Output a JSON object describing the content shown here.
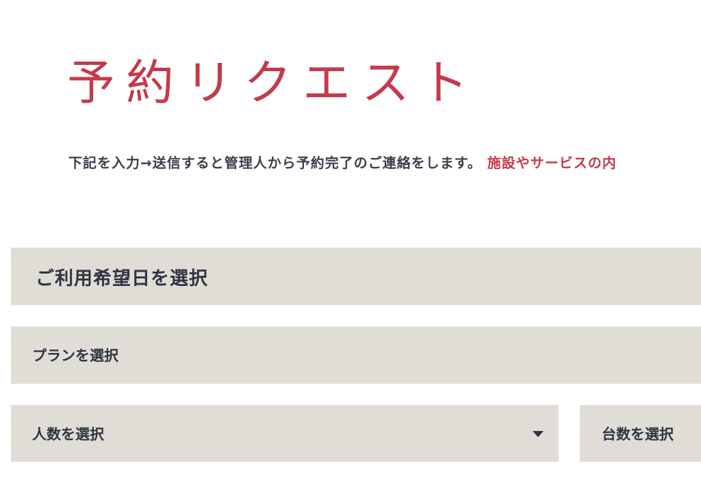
{
  "header": {
    "title": "予約リクエスト"
  },
  "intro": {
    "text": "下記を入力→送信すると管理人から予約完了のご連絡をします。",
    "accent": "施設やサービスの内"
  },
  "form": {
    "date_select": {
      "placeholder": "ご利用希望日を選択"
    },
    "plan_select": {
      "label": "プランを選択"
    },
    "people_select": {
      "label": "人数を選択",
      "icon": "caret-down-icon"
    },
    "cars_select": {
      "label": "台数を選択"
    }
  },
  "colors": {
    "accent": "#c43a4a",
    "field_background": "#e0ddd6",
    "text_dark": "#2f3542",
    "placeholder": "#8b8e95"
  }
}
